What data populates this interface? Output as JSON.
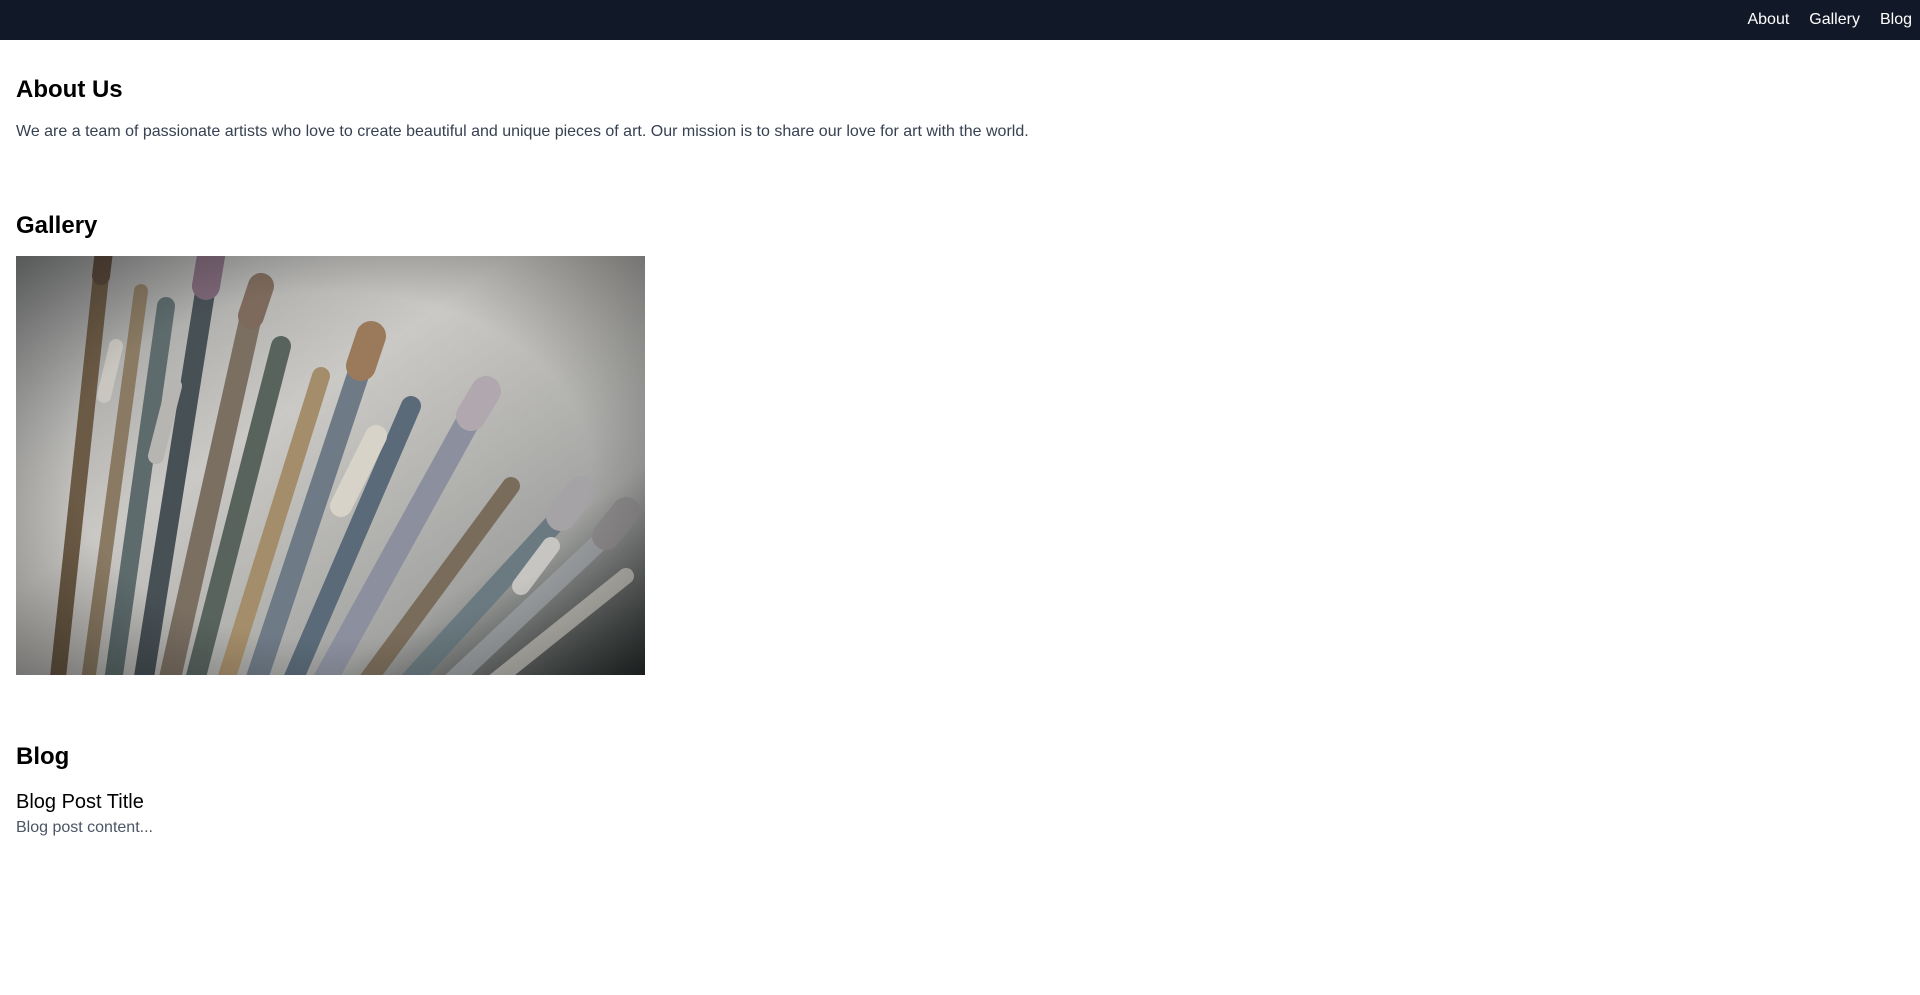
{
  "nav": {
    "items": [
      {
        "label": "About"
      },
      {
        "label": "Gallery"
      },
      {
        "label": "Blog"
      }
    ]
  },
  "about": {
    "title": "About Us",
    "text": "We are a team of passionate artists who love to create beautiful and unique pieces of art. Our mission is to share our love for art with the world."
  },
  "gallery": {
    "title": "Gallery",
    "image_subject": "paint-brushes-photo"
  },
  "blog": {
    "title": "Blog",
    "posts": [
      {
        "title": "Blog Post Title",
        "content": "Blog post content..."
      }
    ]
  },
  "colors": {
    "nav_background": "#111827",
    "nav_text": "#ffffff",
    "body_text": "#374151",
    "heading_text": "#000000"
  }
}
